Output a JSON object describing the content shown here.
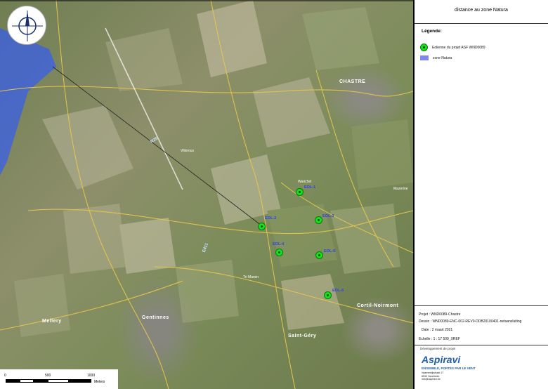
{
  "panel": {
    "title": "distance au zone Natura",
    "legend_heading": "Légende:",
    "legend_items": [
      {
        "label": "Eolienne du projet ASF WND0089",
        "symbol": "turbine-icon",
        "color": "#17e11b"
      },
      {
        "label": "zone Natura",
        "symbol": "natura-zone-swatch",
        "color": "#7f86f0"
      }
    ],
    "project": "Projet : WND0089-Chastre",
    "drawing": "Dessin : WND0089-ENC-002-REV0-DDB20100401-netaansluiting",
    "date": "Date : 2 maart 2021",
    "scale": "Echelle : 1 : 17 500_XREF",
    "developer_label": "Développement de projet",
    "company": "Aspiravi",
    "tagline": "ENSEMBLE, PORTÉS PAR LE VENT",
    "address": [
      "Vaarnewijkstraat 17",
      "8530 Harelbeke",
      "info@aspiravi.be"
    ]
  },
  "map": {
    "places": [
      {
        "name": "CHASTRE",
        "style": "big"
      },
      {
        "name": "Villeroux",
        "style": "normal"
      },
      {
        "name": "Gentinnes",
        "style": "big"
      },
      {
        "name": "Saint-Géry",
        "style": "big"
      },
      {
        "name": "Cortil-Noirmont",
        "style": "big"
      },
      {
        "name": "Mellery",
        "style": "big"
      },
      {
        "name": "Warichet",
        "style": "normal"
      },
      {
        "name": "Tri Marsin",
        "style": "normal"
      },
      {
        "name": "Mazerine",
        "style": "normal"
      }
    ],
    "road_labels": [
      "N25",
      "E411"
    ],
    "turbines": [
      "EOL-1",
      "EOL-2",
      "EOL-3",
      "EOL-4",
      "EOL-5",
      "EOL-6"
    ],
    "scalebar": {
      "ticks": [
        "0",
        "500",
        "1000"
      ],
      "unit": "Meters"
    },
    "natura_color": "#3a5fe8",
    "road_color": "#e8c84a"
  }
}
